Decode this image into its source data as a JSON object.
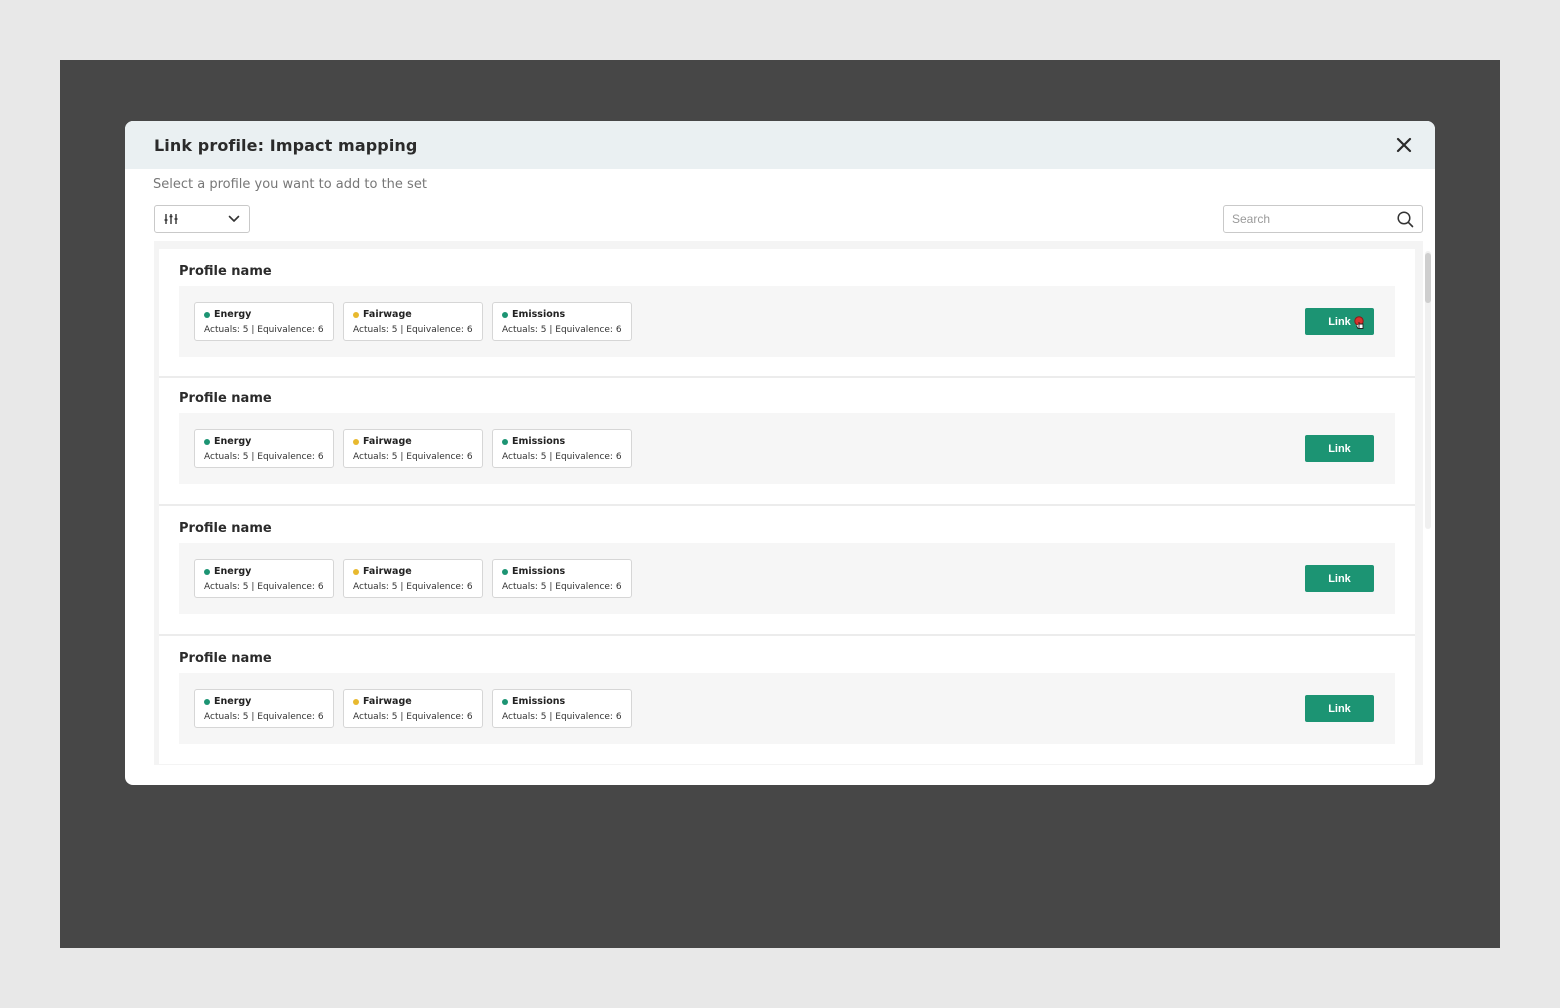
{
  "modal": {
    "title": "Link profile: Impact mapping",
    "subtitle": "Select a profile you want to add to the set",
    "search_placeholder": "Search"
  },
  "profiles": [
    {
      "name": "Profile name",
      "tags": [
        {
          "label": "Energy",
          "stats": "Actuals: 5 | Equivalence: 6",
          "color": "#1c9473"
        },
        {
          "label": "Fairwage",
          "stats": "Actuals: 5 | Equivalence: 6",
          "color": "#e8b92e"
        },
        {
          "label": "Emissions",
          "stats": "Actuals: 5 | Equivalence: 6",
          "color": "#1c9473"
        }
      ],
      "link_label": "Link"
    },
    {
      "name": "Profile name",
      "tags": [
        {
          "label": "Energy",
          "stats": "Actuals: 5 | Equivalence: 6",
          "color": "#1c9473"
        },
        {
          "label": "Fairwage",
          "stats": "Actuals: 5 | Equivalence: 6",
          "color": "#e8b92e"
        },
        {
          "label": "Emissions",
          "stats": "Actuals: 5 | Equivalence: 6",
          "color": "#1c9473"
        }
      ],
      "link_label": "Link"
    },
    {
      "name": "Profile name",
      "tags": [
        {
          "label": "Energy",
          "stats": "Actuals: 5 | Equivalence: 6",
          "color": "#1c9473"
        },
        {
          "label": "Fairwage",
          "stats": "Actuals: 5 | Equivalence: 6",
          "color": "#e8b92e"
        },
        {
          "label": "Emissions",
          "stats": "Actuals: 5 | Equivalence: 6",
          "color": "#1c9473"
        }
      ],
      "link_label": "Link"
    },
    {
      "name": "Profile name",
      "tags": [
        {
          "label": "Energy",
          "stats": "Actuals: 5 | Equivalence: 6",
          "color": "#1c9473"
        },
        {
          "label": "Fairwage",
          "stats": "Actuals: 5 | Equivalence: 6",
          "color": "#e8b92e"
        },
        {
          "label": "Emissions",
          "stats": "Actuals: 5 | Equivalence: 6",
          "color": "#1c9473"
        }
      ],
      "link_label": "Link"
    }
  ],
  "colors": {
    "accent": "#1c9473",
    "header_bg": "#eaf0f2",
    "backdrop": "#474747"
  }
}
